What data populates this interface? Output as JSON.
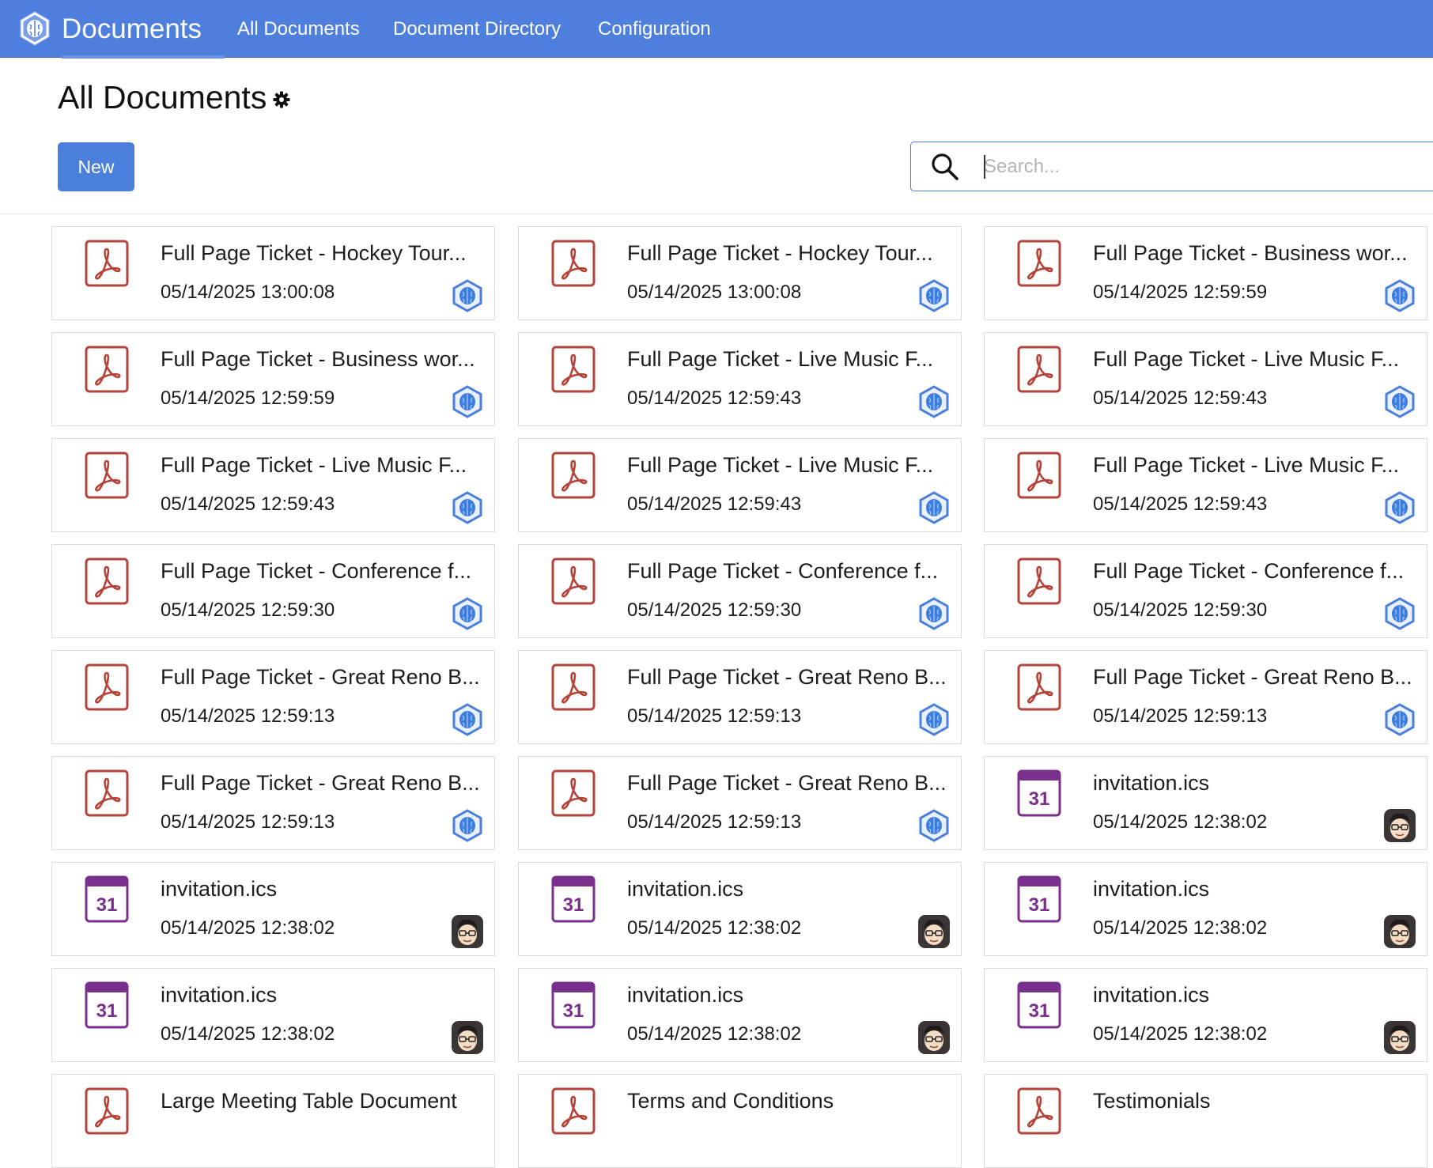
{
  "topbar": {
    "app_title": "Documents",
    "logo_icon": "brain-hex-logo-icon",
    "nav": [
      {
        "label": "All Documents"
      },
      {
        "label": "Document Directory"
      },
      {
        "label": "Configuration"
      }
    ]
  },
  "control_panel": {
    "page_title": "All Documents",
    "settings_icon": "gear-icon",
    "new_label": "New",
    "search_placeholder": "Search..."
  },
  "colors": {
    "topbar": "#4f7fdd",
    "primary": "#4a7fdc",
    "pdf": "#b5433a",
    "calendar": "#7a2f8c"
  },
  "documents": [
    {
      "name": "Full Page Ticket - Hockey Tour...",
      "date": "05/14/2025 13:00:08",
      "icon": "pdf-file-icon",
      "owner": "brain-avatar-icon"
    },
    {
      "name": "Full Page Ticket - Hockey Tour...",
      "date": "05/14/2025 13:00:08",
      "icon": "pdf-file-icon",
      "owner": "brain-avatar-icon"
    },
    {
      "name": "Full Page Ticket - Business wor...",
      "date": "05/14/2025 12:59:59",
      "icon": "pdf-file-icon",
      "owner": "brain-avatar-icon"
    },
    {
      "name": "Full Page Ticket - Business wor...",
      "date": "05/14/2025 12:59:59",
      "icon": "pdf-file-icon",
      "owner": "brain-avatar-icon"
    },
    {
      "name": "Full Page Ticket - Live Music F...",
      "date": "05/14/2025 12:59:43",
      "icon": "pdf-file-icon",
      "owner": "brain-avatar-icon"
    },
    {
      "name": "Full Page Ticket - Live Music F...",
      "date": "05/14/2025 12:59:43",
      "icon": "pdf-file-icon",
      "owner": "brain-avatar-icon"
    },
    {
      "name": "Full Page Ticket - Live Music F...",
      "date": "05/14/2025 12:59:43",
      "icon": "pdf-file-icon",
      "owner": "brain-avatar-icon"
    },
    {
      "name": "Full Page Ticket - Live Music F...",
      "date": "05/14/2025 12:59:43",
      "icon": "pdf-file-icon",
      "owner": "brain-avatar-icon"
    },
    {
      "name": "Full Page Ticket - Live Music F...",
      "date": "05/14/2025 12:59:43",
      "icon": "pdf-file-icon",
      "owner": "brain-avatar-icon"
    },
    {
      "name": "Full Page Ticket - Conference f...",
      "date": "05/14/2025 12:59:30",
      "icon": "pdf-file-icon",
      "owner": "brain-avatar-icon"
    },
    {
      "name": "Full Page Ticket - Conference f...",
      "date": "05/14/2025 12:59:30",
      "icon": "pdf-file-icon",
      "owner": "brain-avatar-icon"
    },
    {
      "name": "Full Page Ticket - Conference f...",
      "date": "05/14/2025 12:59:30",
      "icon": "pdf-file-icon",
      "owner": "brain-avatar-icon"
    },
    {
      "name": "Full Page Ticket - Great Reno B...",
      "date": "05/14/2025 12:59:13",
      "icon": "pdf-file-icon",
      "owner": "brain-avatar-icon"
    },
    {
      "name": "Full Page Ticket - Great Reno B...",
      "date": "05/14/2025 12:59:13",
      "icon": "pdf-file-icon",
      "owner": "brain-avatar-icon"
    },
    {
      "name": "Full Page Ticket - Great Reno B...",
      "date": "05/14/2025 12:59:13",
      "icon": "pdf-file-icon",
      "owner": "brain-avatar-icon"
    },
    {
      "name": "Full Page Ticket - Great Reno B...",
      "date": "05/14/2025 12:59:13",
      "icon": "pdf-file-icon",
      "owner": "brain-avatar-icon"
    },
    {
      "name": "Full Page Ticket - Great Reno B...",
      "date": "05/14/2025 12:59:13",
      "icon": "pdf-file-icon",
      "owner": "brain-avatar-icon"
    },
    {
      "name": "invitation.ics",
      "date": "05/14/2025 12:38:02",
      "icon": "calendar-file-icon",
      "icon_text": "31",
      "owner": "user-avatar-icon"
    },
    {
      "name": "invitation.ics",
      "date": "05/14/2025 12:38:02",
      "icon": "calendar-file-icon",
      "icon_text": "31",
      "owner": "user-avatar-icon"
    },
    {
      "name": "invitation.ics",
      "date": "05/14/2025 12:38:02",
      "icon": "calendar-file-icon",
      "icon_text": "31",
      "owner": "user-avatar-icon"
    },
    {
      "name": "invitation.ics",
      "date": "05/14/2025 12:38:02",
      "icon": "calendar-file-icon",
      "icon_text": "31",
      "owner": "user-avatar-icon"
    },
    {
      "name": "invitation.ics",
      "date": "05/14/2025 12:38:02",
      "icon": "calendar-file-icon",
      "icon_text": "31",
      "owner": "user-avatar-icon"
    },
    {
      "name": "invitation.ics",
      "date": "05/14/2025 12:38:02",
      "icon": "calendar-file-icon",
      "icon_text": "31",
      "owner": "user-avatar-icon"
    },
    {
      "name": "invitation.ics",
      "date": "05/14/2025 12:38:02",
      "icon": "calendar-file-icon",
      "icon_text": "31",
      "owner": "user-avatar-icon"
    },
    {
      "name": "Large Meeting Table Document",
      "date": "",
      "icon": "pdf-file-icon",
      "owner": ""
    },
    {
      "name": "Terms and Conditions",
      "date": "",
      "icon": "pdf-file-icon",
      "owner": ""
    },
    {
      "name": "Testimonials",
      "date": "",
      "icon": "pdf-file-icon",
      "owner": ""
    }
  ]
}
